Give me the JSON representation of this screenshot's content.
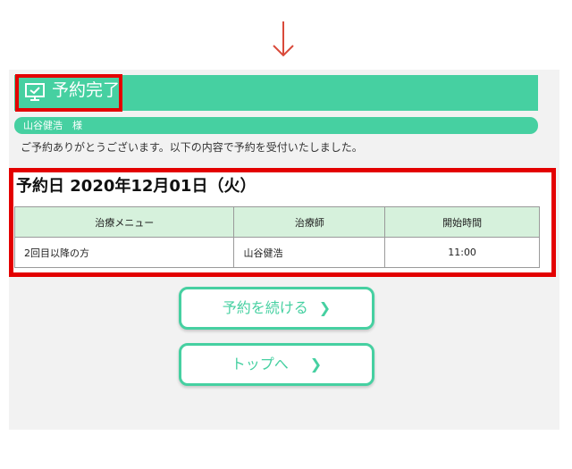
{
  "header": {
    "title": "予約完了"
  },
  "user": {
    "name_line": "山谷健浩　様"
  },
  "message": "ご予約ありがとうございます。以下の内容で予約を受付いたしました。",
  "reservation": {
    "date_line": "予約日 2020年12月01日（火）",
    "columns": [
      "治療メニュー",
      "治療師",
      "開始時間"
    ],
    "rows": [
      [
        "2回目以降の方",
        "山谷健浩",
        "11:00"
      ]
    ]
  },
  "buttons": {
    "continue_label": "予約を続ける",
    "top_label": "トップへ"
  },
  "icons": {
    "down_arrow": "down-arrow-icon",
    "header": "monitor-check-icon",
    "chevron": "chevron-right-icon"
  },
  "colors": {
    "accent": "#46d0a1",
    "highlight": "#e30000",
    "table_header_bg": "#d6f1dc"
  }
}
